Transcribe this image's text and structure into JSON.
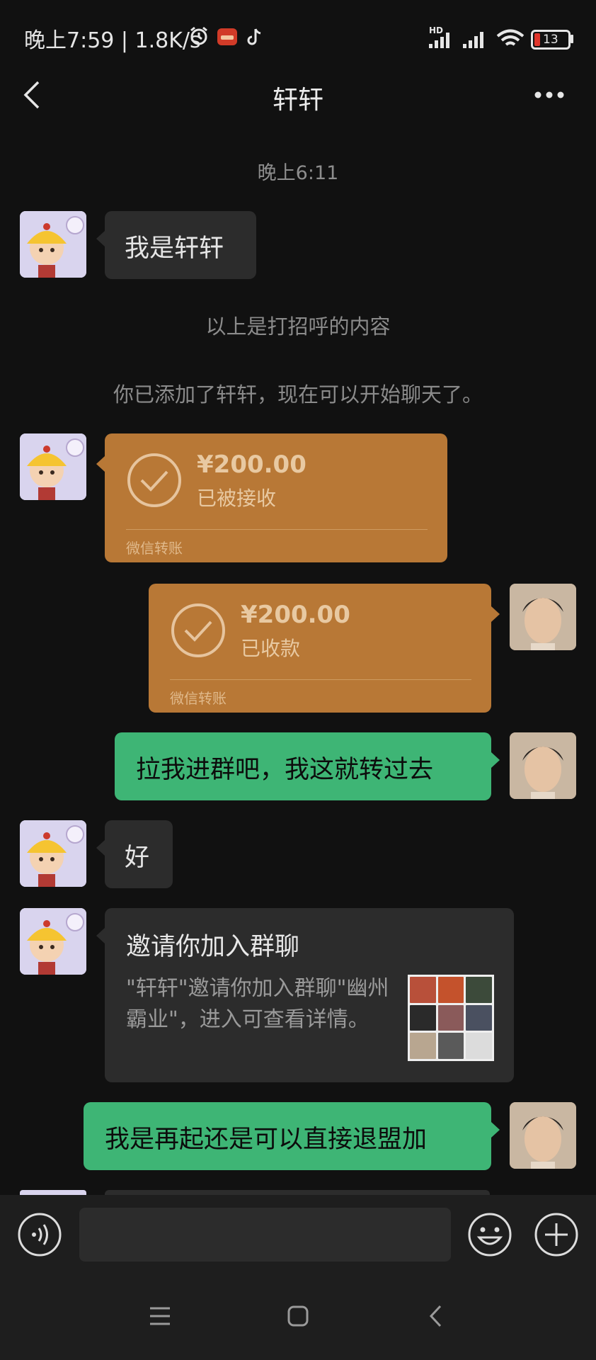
{
  "status_bar": {
    "time_speed": "晚上7:59 | 1.8K/s",
    "hd": "HD",
    "battery": "13"
  },
  "header": {
    "title": "轩轩"
  },
  "chat": {
    "timestamp": "晚上6:11",
    "msg1": "我是轩轩",
    "system_note_1": "以上是打招呼的内容",
    "system_note_2": "你已添加了轩轩，现在可以开始聊天了。",
    "transfer1": {
      "amount": "¥200.00",
      "status": "已被接收",
      "footer": "微信转账"
    },
    "transfer2": {
      "amount": "¥200.00",
      "status": "已收款",
      "footer": "微信转账"
    },
    "msg_pull_group": "拉我进群吧，我这就转过去",
    "msg_ok": "好",
    "invite": {
      "title": "邀请你加入群聊",
      "description": "\"轩轩\"邀请你加入群聊\"幽州霸业\"，进入可查看详情。"
    },
    "msg_last": "我是再起还是可以直接退盟加"
  },
  "colors": {
    "background": "#111111",
    "green_bubble": "#3eb575",
    "transfer": "#b87836",
    "gray_bubble": "#2c2c2c"
  },
  "icons": [
    "back-icon",
    "more-icon",
    "alarm-icon",
    "app-icon",
    "tiktok-icon",
    "signal-icon",
    "wifi-icon",
    "battery-icon",
    "voice-icon",
    "emoji-icon",
    "plus-icon",
    "check-circle-icon",
    "menu-icon",
    "home-icon",
    "nav-back-icon"
  ]
}
